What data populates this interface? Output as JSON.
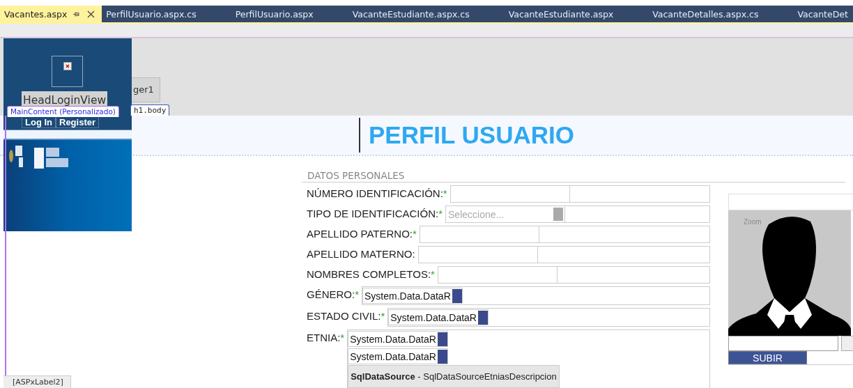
{
  "tabs": [
    {
      "label": "Vacantes.aspx",
      "selected": true
    },
    {
      "label": "PerfilUsuario.aspx.cs",
      "selected": false
    },
    {
      "label": "PerfilUsuario.aspx",
      "selected": false
    },
    {
      "label": "VacanteEstudiante.aspx.cs",
      "selected": false
    },
    {
      "label": "VacanteEstudiante.aspx",
      "selected": false
    },
    {
      "label": "VacanteDetalles.aspx.cs",
      "selected": false
    },
    {
      "label": "VacanteDet",
      "selected": false
    }
  ],
  "designer": {
    "head_login_view": "HeadLoginView",
    "login_links": [
      "Log In",
      "Register"
    ],
    "control_label": "ger1",
    "tags": [
      "MainContent (Personalizado)",
      "h1.body"
    ]
  },
  "page_title": "PERFIL USUARIO",
  "section_title": "DATOS PERSONALES",
  "fields": [
    {
      "label": "NÚMERO IDENTIFICACIÓN:",
      "required_mark": "*",
      "kind": "text"
    },
    {
      "label": "TIPO DE IDENTIFICACIÓN:",
      "required_mark": "*",
      "kind": "combo",
      "placeholder": "Seleccione..."
    },
    {
      "label": "APELLIDO PATERNO:",
      "required_mark": "*",
      "kind": "text"
    },
    {
      "label": "APELLIDO MATERNO:",
      "kind": "text"
    },
    {
      "label": "NOMBRES COMPLETOS:",
      "required_mark": "*",
      "kind": "text"
    },
    {
      "label": "GÉNERO:",
      "required_mark": "*",
      "kind": "list",
      "items": [
        "System.Data.DataR"
      ]
    },
    {
      "label": "ESTADO CIVIL:",
      "required_mark": "*",
      "kind": "list",
      "items": [
        "System.Data.DataR"
      ]
    },
    {
      "label": "ETNIA:",
      "required_mark": "*",
      "kind": "list",
      "items": [
        "System.Data.DataR",
        "System.Data.DataR"
      ],
      "datasource": "**SqlDataSource** - SqlDataSourceEtniasDescripcion"
    }
  ],
  "photo": {
    "zoom_label": "Zoom",
    "upload_button": "SUBIR"
  },
  "footer_tag": "[ASPxLabel2]"
}
